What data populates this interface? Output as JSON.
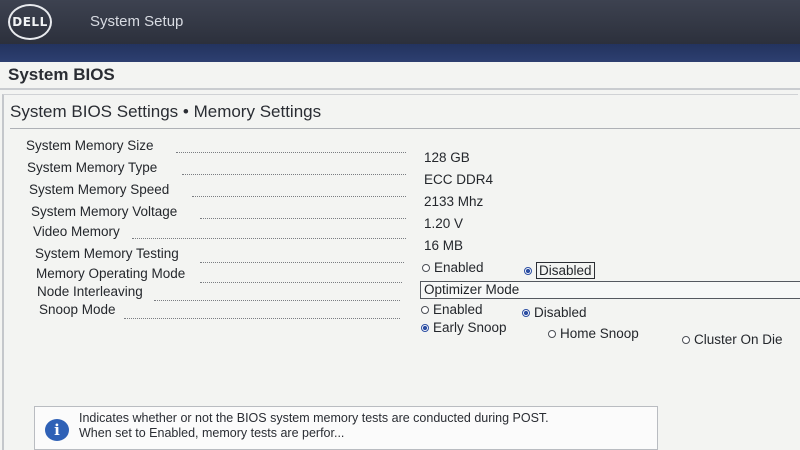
{
  "header": {
    "logo_text": "DELL",
    "app_title": "System Setup"
  },
  "panel": {
    "title": "System BIOS",
    "section_title": "System BIOS Settings • Memory Settings"
  },
  "settings": {
    "memory_size": {
      "label": "System Memory Size",
      "value": "128 GB"
    },
    "memory_type": {
      "label": "System Memory Type",
      "value": "ECC DDR4"
    },
    "memory_speed": {
      "label": "System Memory Speed",
      "value": "2133 Mhz"
    },
    "memory_voltage": {
      "label": "System Memory Voltage",
      "value": "1.20 V"
    },
    "video_memory": {
      "label": "Video Memory",
      "value": "16 MB"
    },
    "memory_testing": {
      "label": "System Memory Testing",
      "options": [
        "Enabled",
        "Disabled"
      ],
      "selected": "Disabled"
    },
    "operating_mode": {
      "label": "Memory Operating Mode",
      "value": "Optimizer Mode"
    },
    "node_interleaving": {
      "label": "Node Interleaving",
      "options": [
        "Enabled",
        "Disabled"
      ],
      "selected": "Disabled"
    },
    "snoop_mode": {
      "label": "Snoop Mode",
      "options": [
        "Early Snoop",
        "Home Snoop",
        "Cluster On Die"
      ],
      "selected": "Early Snoop"
    }
  },
  "help": {
    "icon": "info-icon",
    "line1": "Indicates whether or not the BIOS system memory tests are conducted during POST.",
    "line2": "When set to Enabled, memory tests are perfor..."
  },
  "colors": {
    "header_bg": "#2c303c",
    "accent_blue": "#2d3f70",
    "radio_selected": "#2d4fa3",
    "info_icon": "#2f61b6"
  }
}
